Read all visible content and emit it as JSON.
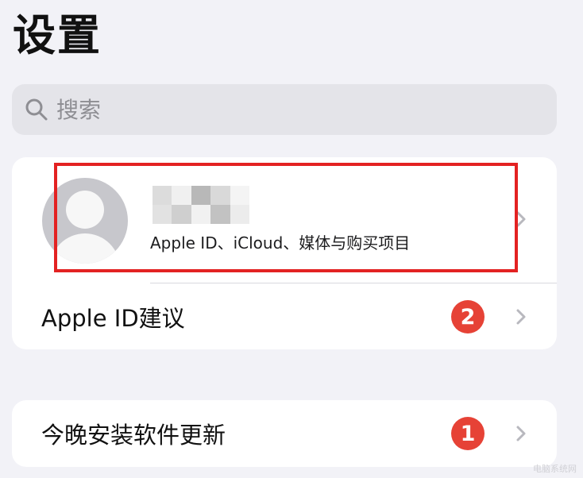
{
  "page": {
    "title": "设置"
  },
  "search": {
    "placeholder": "搜索"
  },
  "profile": {
    "subtitle": "Apple ID、iCloud、媒体与购买项目",
    "mosaic_colors": [
      "#dcdcdc",
      "#f0f0f0",
      "#b8b8b8",
      "#d9d9d9",
      "#f4f4f4",
      "#e2e2e2",
      "#cfcfcf",
      "#f1f1f1",
      "#c2c2c2",
      "#ececec"
    ]
  },
  "apple_id_suggestions": {
    "label": "Apple ID建议",
    "badge": "2"
  },
  "software_update": {
    "label": "今晚安装软件更新",
    "badge": "1"
  },
  "watermark": {
    "text": "电脑系统网"
  },
  "colors": {
    "background": "#f2f2f7",
    "card": "#ffffff",
    "search_bar": "#e4e4e9",
    "badge": "#e64236",
    "highlight": "#e32222"
  },
  "icons": {
    "search": "search-icon",
    "chevron": "chevron-right-icon",
    "avatar": "default-avatar-icon"
  }
}
